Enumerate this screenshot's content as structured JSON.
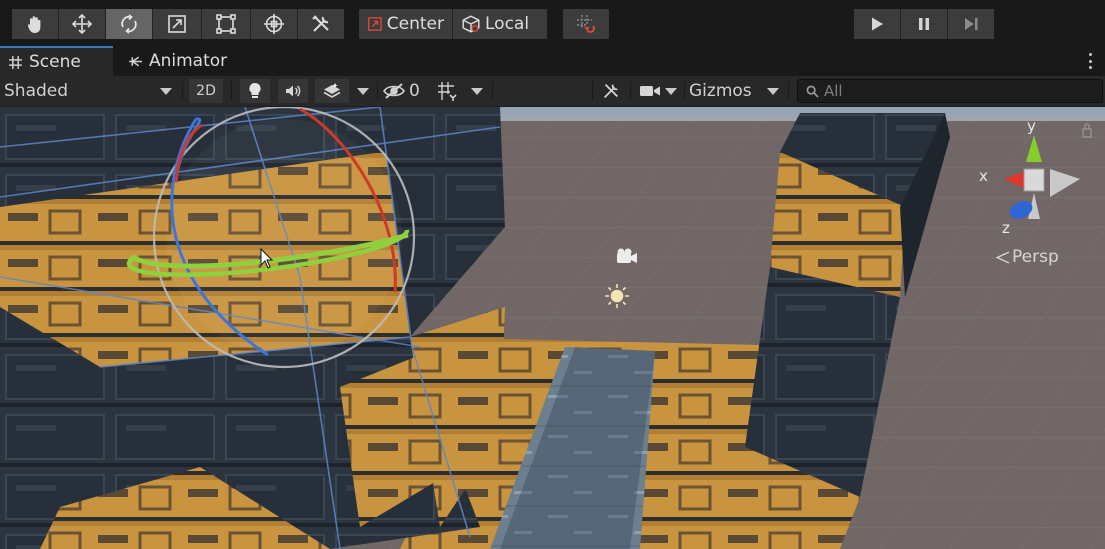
{
  "toolbar": {
    "tools": [
      {
        "name": "hand-tool",
        "icon": "hand-icon",
        "active": false
      },
      {
        "name": "move-tool",
        "icon": "move-icon",
        "active": false
      },
      {
        "name": "rotate-tool",
        "icon": "rotate-icon",
        "active": true
      },
      {
        "name": "scale-tool",
        "icon": "scale-icon",
        "active": false
      },
      {
        "name": "rect-tool",
        "icon": "rect-transform-icon",
        "active": false
      },
      {
        "name": "transform-tool",
        "icon": "transform-icon",
        "active": false
      },
      {
        "name": "custom-tool",
        "icon": "custom-tools-icon",
        "active": false
      }
    ],
    "pivot_mode_label": "Center",
    "pivot_rotation_label": "Local",
    "snap_icon": "grid-snap-icon",
    "playback": {
      "play_icon": "play-icon",
      "pause_icon": "pause-icon",
      "step_icon": "step-icon"
    }
  },
  "tabs": [
    {
      "label": "Scene",
      "icon": "scene-grid-icon",
      "active": true
    },
    {
      "label": "Animator",
      "icon": "animator-icon",
      "active": false
    }
  ],
  "scene_toolbar": {
    "draw_mode": "Shaded",
    "toggle_2d": "2D",
    "hidden_count": "0",
    "gizmos_label": "Gizmos",
    "search_placeholder": "All"
  },
  "viewport": {
    "orientation_gizmo": {
      "x_label": "x",
      "y_label": "y",
      "z_label": "z",
      "projection_label": "Persp"
    },
    "colors": {
      "x_axis": "#e2362c",
      "y_axis": "#86cc2d",
      "z_axis": "#2f66d6",
      "rotate_x_ring": "#cc3a2a",
      "rotate_y_ring": "#8fd13c",
      "rotate_z_ring": "#3d76d8",
      "crate_orange": "#c9943f",
      "crate_dark": "#2c3540",
      "floor": "#6f6564"
    }
  },
  "colors": {
    "accent": "#3a79bb",
    "toolbar_bg": "#191919",
    "button_bg": "#3c3c3c",
    "button_active_bg": "#656565"
  }
}
